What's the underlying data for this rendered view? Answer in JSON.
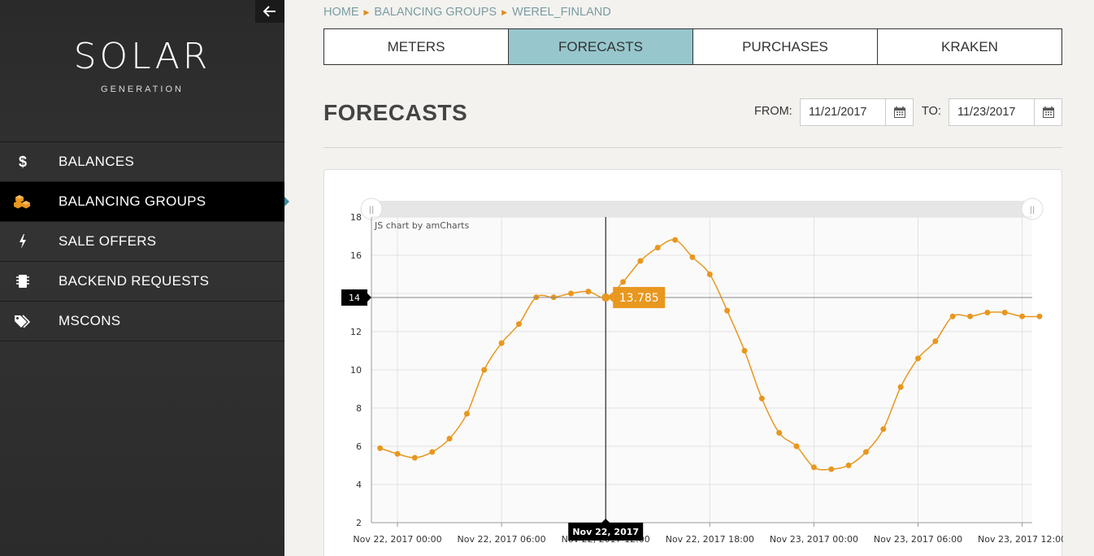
{
  "sidebar": {
    "logo_title": "SOLAR",
    "logo_subtitle": "GENERATION",
    "items": [
      {
        "label": "BALANCES",
        "icon": "dollar-icon",
        "active": false
      },
      {
        "label": "BALANCING GROUPS",
        "icon": "cubes-icon",
        "active": true
      },
      {
        "label": "SALE OFFERS",
        "icon": "bolt-icon",
        "active": false
      },
      {
        "label": "BACKEND REQUESTS",
        "icon": "chip-icon",
        "active": false
      },
      {
        "label": "MSCONS",
        "icon": "tags-icon",
        "active": false
      }
    ],
    "collapse_icon": "arrow-left-icon"
  },
  "breadcrumb": [
    "HOME",
    "BALANCING GROUPS",
    "WEREL_FINLAND"
  ],
  "tabs": [
    {
      "label": "METERS",
      "active": false
    },
    {
      "label": "FORECASTS",
      "active": true
    },
    {
      "label": "PURCHASES",
      "active": false
    },
    {
      "label": "KRAKEN",
      "active": false
    }
  ],
  "page": {
    "title": "FORECASTS",
    "from_label": "FROM:",
    "from_value": "11/21/2017",
    "to_label": "TO:",
    "to_value": "11/23/2017"
  },
  "colors": {
    "accent": "#e8971f",
    "tab_active": "#97c7cd",
    "sidebar_bg": "#2e2e2e",
    "breadcrumb": "#7a9ca2"
  },
  "chart_data": {
    "type": "line",
    "credit": "JS chart by amCharts",
    "ylim": [
      2,
      18
    ],
    "yticks": [
      2,
      4,
      6,
      8,
      10,
      12,
      14,
      16,
      18
    ],
    "xticks": [
      "Nov 22, 2017 00:00",
      "Nov 22, 2017 06:00",
      "Nov 22, 2017 12:00",
      "Nov 22, 2017 18:00",
      "Nov 23, 2017 00:00",
      "Nov 23, 2017 06:00",
      "Nov 23, 2017 12:00"
    ],
    "series": [
      {
        "x_hours": [
          -1,
          0,
          1,
          2,
          3,
          4,
          5,
          6,
          7,
          8,
          9,
          10,
          11,
          12,
          13,
          14,
          15,
          16,
          17,
          18,
          19,
          20,
          21,
          22,
          23,
          24,
          25,
          26,
          27,
          28,
          29,
          30,
          31,
          32,
          33,
          34,
          35,
          36,
          37
        ],
        "values": [
          5.9,
          5.6,
          5.4,
          5.7,
          6.4,
          7.7,
          10.0,
          11.4,
          12.4,
          13.8,
          13.8,
          14.0,
          14.1,
          13.785,
          14.6,
          15.7,
          16.4,
          16.8,
          15.9,
          15.0,
          13.1,
          11.0,
          8.5,
          6.7,
          6.0,
          4.9,
          4.8,
          5.0,
          5.7,
          6.9,
          9.1,
          10.6,
          11.5,
          12.8,
          12.8,
          13.0,
          13.0,
          12.8,
          12.8
        ]
      }
    ],
    "cursor": {
      "label": "Nov 22, 2017",
      "value_label": "13.785",
      "y_tick_label": "14"
    }
  }
}
